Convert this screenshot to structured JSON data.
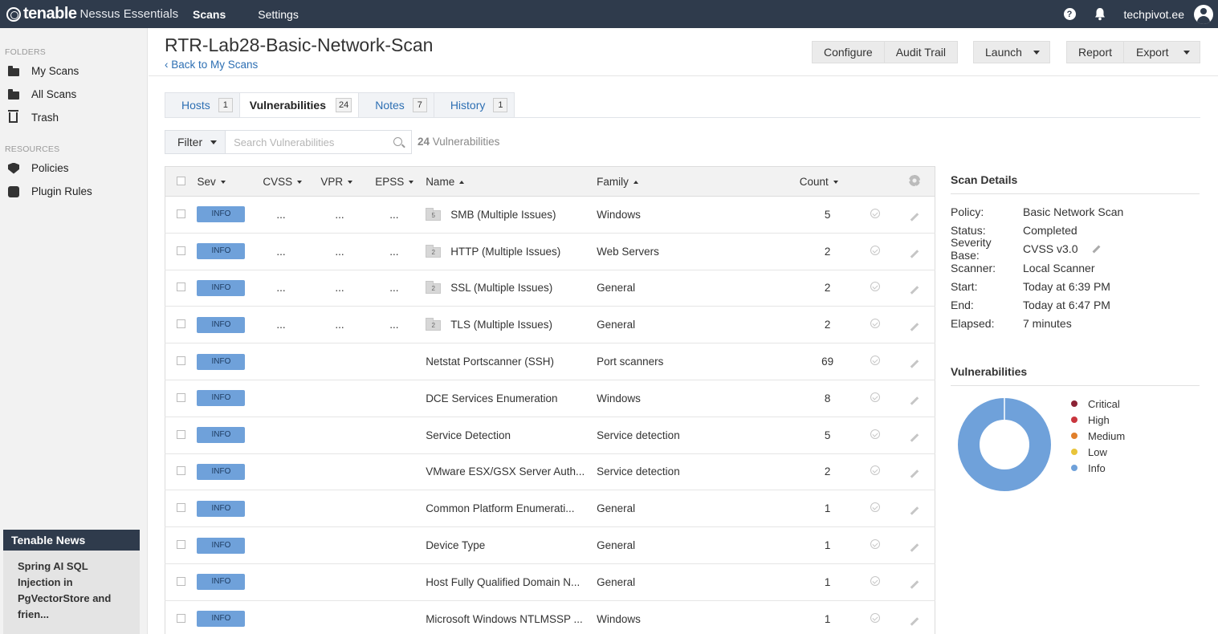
{
  "topnav": {
    "brand": "tenable",
    "product": "Nessus Essentials",
    "items": [
      "Scans",
      "Settings"
    ],
    "help": "?",
    "user": "techpivot.ee"
  },
  "sidebar": {
    "folders_heading": "FOLDERS",
    "folders": [
      "My Scans",
      "All Scans",
      "Trash"
    ],
    "resources_heading": "RESOURCES",
    "resources": [
      "Policies",
      "Plugin Rules"
    ],
    "news": {
      "title": "Tenable News",
      "headline": "Spring AI SQL Injection in PgVectorStore and frien..."
    }
  },
  "header": {
    "title": "RTR-Lab28-Basic-Network-Scan",
    "back_link": "Back to My Scans",
    "buttons": {
      "configure": "Configure",
      "audit_trail": "Audit Trail",
      "launch": "Launch",
      "report": "Report",
      "export": "Export"
    }
  },
  "tabs": [
    {
      "label": "Hosts",
      "count": "1"
    },
    {
      "label": "Vulnerabilities",
      "count": "24"
    },
    {
      "label": "Notes",
      "count": "7"
    },
    {
      "label": "History",
      "count": "1"
    }
  ],
  "filter": {
    "label": "Filter",
    "placeholder": "Search Vulnerabilities",
    "count": "24",
    "count_suffix": " Vulnerabilities"
  },
  "table": {
    "columns": [
      "Sev",
      "CVSS",
      "VPR",
      "EPSS",
      "Name",
      "Family",
      "Count"
    ],
    "rows": [
      {
        "sev": "INFO",
        "cvss": "...",
        "vpr": "...",
        "epss": "...",
        "group": "5",
        "name": "SMB (Multiple Issues)",
        "family": "Windows",
        "count": "5"
      },
      {
        "sev": "INFO",
        "cvss": "...",
        "vpr": "...",
        "epss": "...",
        "group": "2",
        "name": "HTTP (Multiple Issues)",
        "family": "Web Servers",
        "count": "2"
      },
      {
        "sev": "INFO",
        "cvss": "...",
        "vpr": "...",
        "epss": "...",
        "group": "2",
        "name": "SSL (Multiple Issues)",
        "family": "General",
        "count": "2"
      },
      {
        "sev": "INFO",
        "cvss": "...",
        "vpr": "...",
        "epss": "...",
        "group": "2",
        "name": "TLS (Multiple Issues)",
        "family": "General",
        "count": "2"
      },
      {
        "sev": "INFO",
        "cvss": "",
        "vpr": "",
        "epss": "",
        "group": "",
        "name": "Netstat Portscanner (SSH)",
        "family": "Port scanners",
        "count": "69"
      },
      {
        "sev": "INFO",
        "cvss": "",
        "vpr": "",
        "epss": "",
        "group": "",
        "name": "DCE Services Enumeration",
        "family": "Windows",
        "count": "8"
      },
      {
        "sev": "INFO",
        "cvss": "",
        "vpr": "",
        "epss": "",
        "group": "",
        "name": "Service Detection",
        "family": "Service detection",
        "count": "5"
      },
      {
        "sev": "INFO",
        "cvss": "",
        "vpr": "",
        "epss": "",
        "group": "",
        "name": "VMware ESX/GSX Server Auth...",
        "family": "Service detection",
        "count": "2"
      },
      {
        "sev": "INFO",
        "cvss": "",
        "vpr": "",
        "epss": "",
        "group": "",
        "name": "Common Platform Enumerati...",
        "family": "General",
        "count": "1"
      },
      {
        "sev": "INFO",
        "cvss": "",
        "vpr": "",
        "epss": "",
        "group": "",
        "name": "Device Type",
        "family": "General",
        "count": "1"
      },
      {
        "sev": "INFO",
        "cvss": "",
        "vpr": "",
        "epss": "",
        "group": "",
        "name": "Host Fully Qualified Domain N...",
        "family": "General",
        "count": "1"
      },
      {
        "sev": "INFO",
        "cvss": "",
        "vpr": "",
        "epss": "",
        "group": "",
        "name": "Microsoft Windows NTLMSSP ...",
        "family": "Windows",
        "count": "1"
      }
    ]
  },
  "scan_details": {
    "title": "Scan Details",
    "rows": [
      {
        "key": "Policy:",
        "value": "Basic Network Scan"
      },
      {
        "key": "Status:",
        "value": "Completed"
      },
      {
        "key": "Severity Base:",
        "value": "CVSS v3.0"
      },
      {
        "key": "Scanner:",
        "value": "Local Scanner"
      },
      {
        "key": "Start:",
        "value": "Today at 6:39 PM"
      },
      {
        "key": "End:",
        "value": "Today at 6:47 PM"
      },
      {
        "key": "Elapsed:",
        "value": "7 minutes"
      }
    ]
  },
  "vulnerabilities_chart": {
    "title": "Vulnerabilities",
    "legend": [
      {
        "label": "Critical",
        "color": "#8c2335"
      },
      {
        "label": "High",
        "color": "#c9363e"
      },
      {
        "label": "Medium",
        "color": "#e07f2b"
      },
      {
        "label": "Low",
        "color": "#e8c43a"
      },
      {
        "label": "Info",
        "color": "#6fa1da"
      }
    ],
    "chart_data": {
      "type": "pie",
      "categories": [
        "Critical",
        "High",
        "Medium",
        "Low",
        "Info"
      ],
      "values": [
        0,
        0,
        0,
        0,
        24
      ]
    }
  },
  "colors": {
    "nav_bg": "#2f3b4c",
    "link": "#2d6fb3",
    "info_badge": "#6fa1da"
  }
}
